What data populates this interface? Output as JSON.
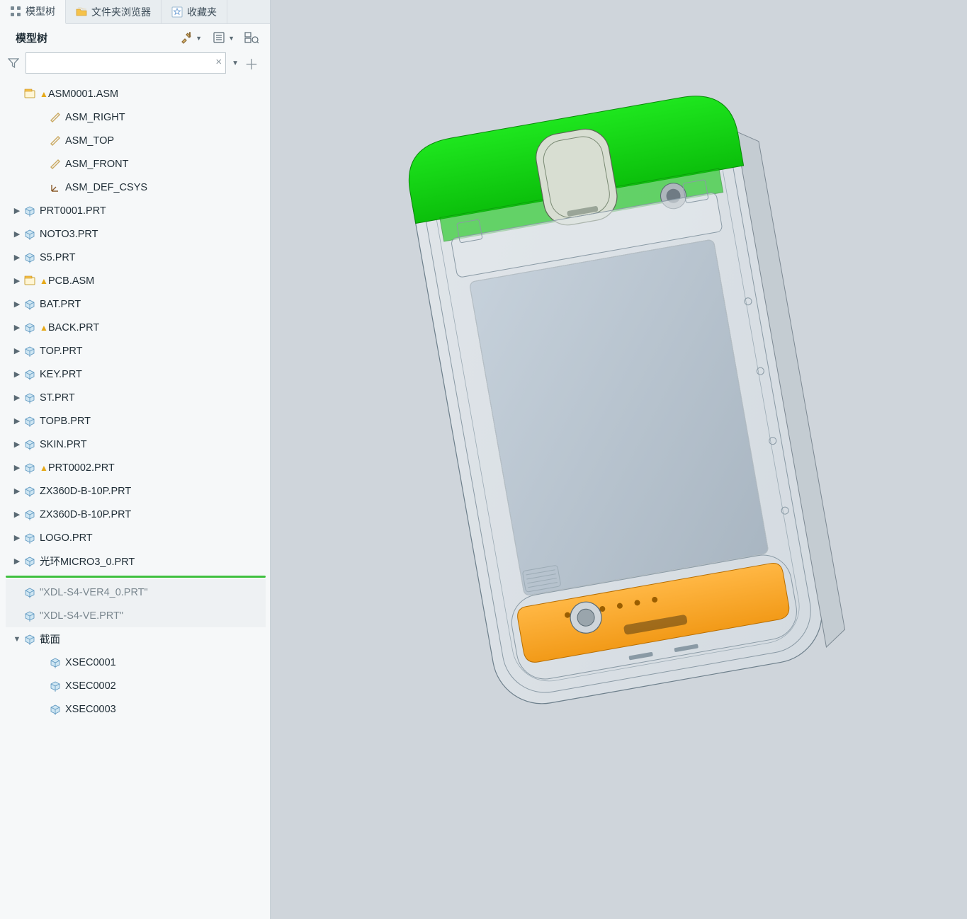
{
  "tabs": [
    {
      "label": "模型树",
      "icon": "tree"
    },
    {
      "label": "文件夹浏览器",
      "icon": "folder"
    },
    {
      "label": "收藏夹",
      "icon": "star"
    }
  ],
  "section_title": "模型树",
  "search": {
    "value": "",
    "placeholder": ""
  },
  "tree": {
    "root": {
      "label": "ASM0001.ASM",
      "warn": true
    },
    "datums": [
      {
        "label": "ASM_RIGHT",
        "icon": "plane"
      },
      {
        "label": "ASM_TOP",
        "icon": "plane"
      },
      {
        "label": "ASM_FRONT",
        "icon": "plane"
      },
      {
        "label": "ASM_DEF_CSYS",
        "icon": "csys"
      }
    ],
    "parts": [
      {
        "label": "PRT0001.PRT",
        "warn": false
      },
      {
        "label": "NOTO3.PRT",
        "warn": false
      },
      {
        "label": "S5.PRT",
        "warn": false
      },
      {
        "label": "PCB.ASM",
        "warn": true,
        "asm": true
      },
      {
        "label": "BAT.PRT",
        "warn": false
      },
      {
        "label": "BACK.PRT",
        "warn": true
      },
      {
        "label": "TOP.PRT",
        "warn": false
      },
      {
        "label": "KEY.PRT",
        "warn": false
      },
      {
        "label": "ST.PRT",
        "warn": false
      },
      {
        "label": "TOPB.PRT",
        "warn": false
      },
      {
        "label": "SKIN.PRT",
        "warn": false
      },
      {
        "label": "PRT0002.PRT",
        "warn": true
      },
      {
        "label": "ZX360D-B-10P.PRT",
        "warn": false
      },
      {
        "label": "ZX360D-B-10P.PRT",
        "warn": false
      },
      {
        "label": "LOGO.PRT",
        "warn": false
      },
      {
        "label": "光环MICRO3_0.PRT",
        "warn": false
      }
    ],
    "suppressed": [
      {
        "label": "XDL-S4-VER4_0.PRT"
      },
      {
        "label": "XDL-S4-VE.PRT"
      }
    ],
    "footer_group": {
      "label": "截面"
    },
    "sections": [
      {
        "label": "XSEC0001"
      },
      {
        "label": "XSEC0002"
      },
      {
        "label": "XSEC0003"
      }
    ]
  }
}
